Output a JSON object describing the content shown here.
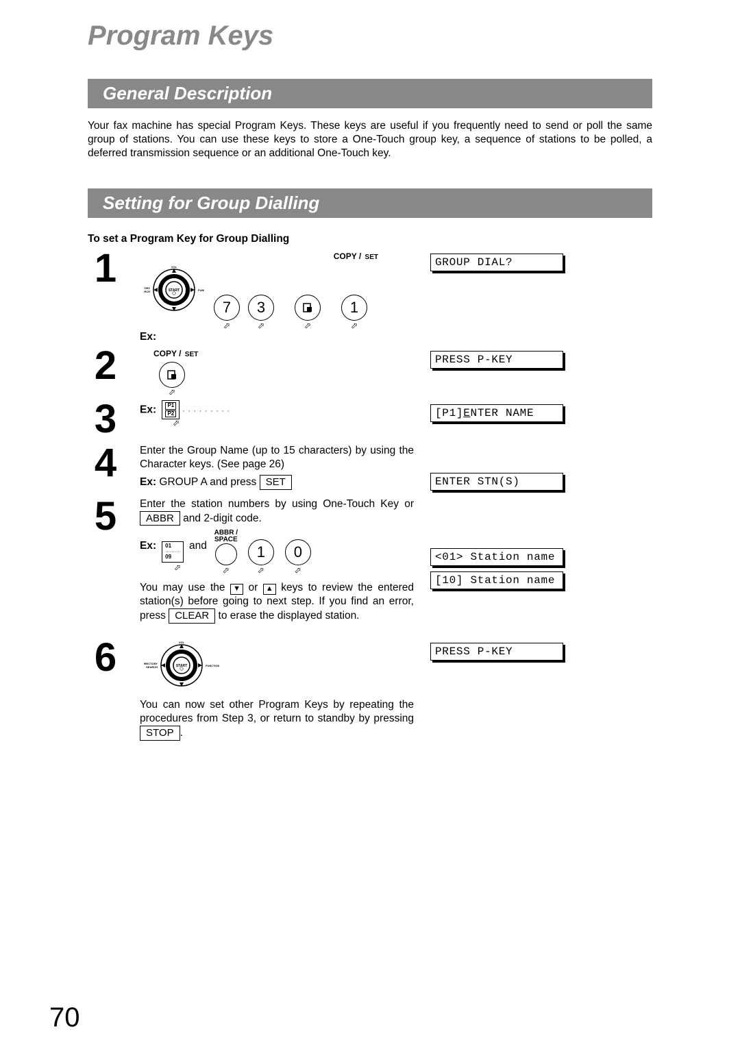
{
  "page_title": "Program Keys",
  "page_number": "70",
  "sections": {
    "general": {
      "heading": "General Description",
      "body": "Your fax machine has special Program Keys. These keys are useful if you frequently need to send or poll the same group of stations. You can use these keys to store a One-Touch group key, a sequence of stations to be polled, a deferred transmission sequence or an additional One-Touch key."
    },
    "group_dial": {
      "heading": "Setting for Group Dialling",
      "subheading": "To set a Program Key for Group Dialling",
      "steps": {
        "s1": {
          "num": "1",
          "copy_set": "COPY / ",
          "copy_set_small": "SET",
          "dial_labels": {
            "top": "VOL",
            "left": "DIRECTORY\nSEARCH",
            "center": "START",
            "right": "FUNCTION"
          },
          "k7": "7",
          "k3": "3",
          "k1": "1",
          "ex": "Ex:",
          "display": "GROUP DIAL?"
        },
        "s2": {
          "num": "2",
          "copy_set": "COPY / ",
          "copy_set_small": "SET",
          "display": "PRESS P-KEY"
        },
        "s3": {
          "num": "3",
          "ex": "Ex:",
          "p1": "P1",
          "p2": "P2",
          "display_pre": "[P1]",
          "display_u": "E",
          "display_post": "NTER NAME"
        },
        "s4": {
          "num": "4",
          "line1": "Enter the Group Name (up to 15 characters) by using the Character keys.  (See page 26)",
          "ex": "Ex:",
          "ex_text": " GROUP A and press ",
          "set": "SET",
          "display": "ENTER STN(S)"
        },
        "s5": {
          "num": "5",
          "line1": "Enter the station numbers by using One-Touch Key or ",
          "abbr": "ABBR",
          "line1b": " and 2-digit code.",
          "abbr_label1": "ABBR /",
          "abbr_label2": "SPACE",
          "ex": "Ex:",
          "and": "and",
          "ot01": "01",
          "ot09": "09",
          "k1": "1",
          "k0": "0",
          "line2a": "You may use the ",
          "down": "▼",
          "or": " or ",
          "up": "▲",
          "line2b": " keys to review the entered station(s) before going to next step. If you find an error, press ",
          "clear": "CLEAR",
          "line2c": " to erase the displayed station.",
          "display1": "<01> Station name",
          "display2": "[10] Station name"
        },
        "s6": {
          "num": "6",
          "dial_labels": {
            "top": "VOL",
            "left": "DIRECTORY\nSEARCH",
            "center": "START",
            "right": "FUNCTION"
          },
          "line1": "You can now set other Program Keys by repeating the procedures from Step 3, or return to standby by pressing ",
          "stop": "STOP",
          "dot": ".",
          "display": "PRESS P-KEY"
        }
      }
    }
  }
}
